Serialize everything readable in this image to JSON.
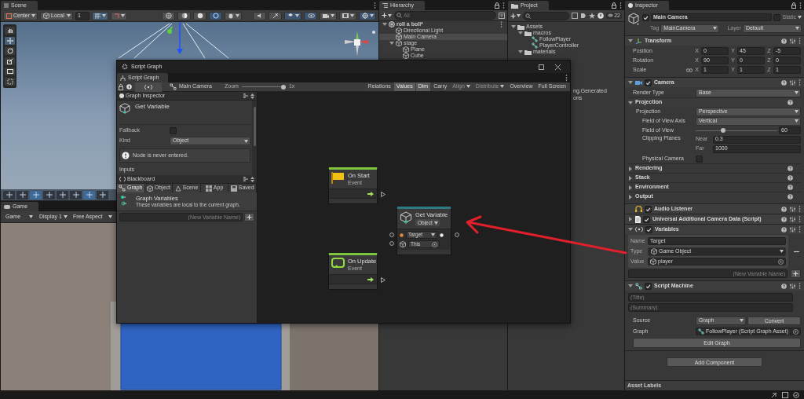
{
  "scene": {
    "tab": "Scene",
    "pivot": "Center",
    "space": "Local",
    "grid_size": "1"
  },
  "game": {
    "tab": "Game",
    "view": "Game",
    "display": "Display 1",
    "aspect": "Free Aspect"
  },
  "hierarchy": {
    "tab": "Hierarchy",
    "search_placeholder": "All",
    "items": [
      {
        "label": "roll a boll*",
        "kind": "scene",
        "selected": false,
        "expanded": true,
        "children": [
          {
            "label": "Directional Light",
            "kind": "object",
            "selected": false
          },
          {
            "label": "Main Camera",
            "kind": "object",
            "selected": true
          },
          {
            "label": "stage",
            "kind": "object",
            "selected": false,
            "expanded": true,
            "children": [
              {
                "label": "Plane",
                "kind": "object",
                "selected": false
              },
              {
                "label": "Cube",
                "kind": "object",
                "selected": false
              }
            ]
          }
        ]
      }
    ]
  },
  "project": {
    "tab": "Project",
    "count": "22",
    "items": [
      {
        "label": "Assets",
        "kind": "folder",
        "expanded": true,
        "children": [
          {
            "label": "macros",
            "kind": "folder",
            "expanded": true,
            "children": [
              {
                "label": "FollowPlayer",
                "kind": "graph"
              },
              {
                "label": "PlayerController",
                "kind": "graph"
              }
            ]
          },
          {
            "label": "materials",
            "kind": "folder",
            "expanded": true
          }
        ]
      }
    ],
    "cut_lines": [
      "ng.Generated",
      "ons"
    ]
  },
  "inspector": {
    "tab": "Inspector",
    "object": {
      "name": "Main Camera",
      "active": true,
      "static_label": "Static",
      "static": false,
      "tag_label": "Tag",
      "tag": "MainCamera",
      "layer_label": "Layer",
      "layer": "Default"
    },
    "components": [
      {
        "kind": "transform",
        "title": "Transform",
        "expanded": true,
        "rows": [
          {
            "label": "Position",
            "constrain": false,
            "fields": [
              {
                "axis": "X",
                "value": "0"
              },
              {
                "axis": "Y",
                "value": "45"
              },
              {
                "axis": "Z",
                "value": "-5"
              }
            ]
          },
          {
            "label": "Rotation",
            "constrain": false,
            "fields": [
              {
                "axis": "X",
                "value": "90"
              },
              {
                "axis": "Y",
                "value": "0"
              },
              {
                "axis": "Z",
                "value": "0"
              }
            ]
          },
          {
            "label": "Scale",
            "constrain": true,
            "fields": [
              {
                "axis": "X",
                "value": "1"
              },
              {
                "axis": "Y",
                "value": "1"
              },
              {
                "axis": "Z",
                "value": "1"
              }
            ]
          }
        ]
      },
      {
        "kind": "camera",
        "title": "Camera",
        "enabled": true,
        "expanded": true,
        "render_type": {
          "label": "Render Type",
          "value": "Base"
        },
        "sections": [
          {
            "title": "Projection",
            "expanded": true,
            "props": [
              {
                "kind": "dropdown",
                "label": "Projection",
                "value": "Perspective"
              },
              {
                "kind": "dropdown",
                "label": "Field of View Axis",
                "value": "Vertical"
              },
              {
                "kind": "slider",
                "label": "Field of View",
                "level": 0.34,
                "value": "60"
              },
              {
                "kind": "pair",
                "label": "Clipping Planes",
                "fields": [
                  {
                    "label": "Near",
                    "value": "0.3"
                  },
                  {
                    "label": "Far",
                    "value": "1000"
                  }
                ]
              },
              {
                "kind": "checkbox",
                "label": "Physical Camera",
                "checked": false
              }
            ]
          },
          {
            "title": "Rendering",
            "expanded": false
          },
          {
            "title": "Stack",
            "expanded": false
          },
          {
            "title": "Environment",
            "expanded": false
          },
          {
            "title": "Output",
            "expanded": false
          }
        ]
      },
      {
        "kind": "audio_listener",
        "title": "Audio Listener",
        "enabled": true
      },
      {
        "kind": "script",
        "title": "Universal Additional Camera Data (Script)",
        "enabled": true,
        "expanded": false
      },
      {
        "kind": "variables",
        "title": "Variables",
        "enabled": true,
        "expanded": true,
        "vars": [
          {
            "name_label": "Name",
            "name": "Target",
            "type_label": "Type",
            "type": "Game Object",
            "value_label": "Value",
            "value": "player"
          }
        ],
        "new_placeholder": "(New Variable Name)"
      },
      {
        "kind": "script_machine",
        "title": "Script Machine",
        "enabled": true,
        "expanded": true,
        "title_placeholder": "(Title)",
        "summary_placeholder": "(Summary)",
        "source_label": "Source",
        "source": "Graph",
        "convert": "Convert",
        "graph_label": "Graph",
        "graph": "FollowPlayer (Script Graph Asset)",
        "edit": "Edit Graph"
      }
    ],
    "add_component": "Add Component",
    "asset_labels": "Asset Labels"
  },
  "script_graph": {
    "window_title": "Script Graph",
    "tab": "Script Graph",
    "breadcrumb": "Main Camera",
    "zoom": {
      "label": "Zoom",
      "level": 0.95,
      "reading": "1x"
    },
    "tools": [
      {
        "label": "Relations",
        "selected": false,
        "disabled": false,
        "dropdown": false
      },
      {
        "label": "Values",
        "selected": true,
        "disabled": false,
        "dropdown": false
      },
      {
        "label": "Dim",
        "selected": true,
        "disabled": false,
        "dropdown": false
      },
      {
        "label": "Carry",
        "selected": false,
        "disabled": false,
        "dropdown": false
      },
      {
        "label": "Align",
        "selected": false,
        "disabled": true,
        "dropdown": true
      },
      {
        "label": "Distribute",
        "selected": false,
        "disabled": true,
        "dropdown": true
      },
      {
        "label": "Overview",
        "selected": false,
        "disabled": false,
        "dropdown": false
      },
      {
        "label": "Full Screen",
        "selected": false,
        "disabled": false,
        "dropdown": false
      }
    ],
    "graph_inspector": {
      "title": "Graph Inspector",
      "node_title": "Get Variable",
      "props": [
        {
          "kind": "checkbox",
          "label": "Fallback",
          "checked": false
        },
        {
          "kind": "dropdown",
          "label": "Kind",
          "value": "Object"
        }
      ],
      "warning": "Node is never entered.",
      "section": "Inputs"
    },
    "blackboard": {
      "title": "Blackboard",
      "tabs": [
        {
          "label": "Graph",
          "selected": true
        },
        {
          "label": "Object",
          "selected": false
        },
        {
          "label": "Scene",
          "selected": false
        },
        {
          "label": "App",
          "selected": false
        },
        {
          "label": "Saved",
          "selected": false
        }
      ],
      "heading": "Graph Variables",
      "description": "These variables are local to the current graph.",
      "new_placeholder": "(New Variable Name)"
    },
    "nodes": [
      {
        "kind": "on_start",
        "title": "On Start",
        "subtitle": "Event"
      },
      {
        "kind": "get_variable",
        "title": "Get Variable",
        "kind_value": "Object",
        "ports": [
          {
            "value": "Target",
            "dropdown": true
          },
          {
            "value": "This",
            "dropdown": false
          }
        ]
      },
      {
        "kind": "on_update",
        "title": "On Update",
        "subtitle": "Event"
      }
    ]
  }
}
